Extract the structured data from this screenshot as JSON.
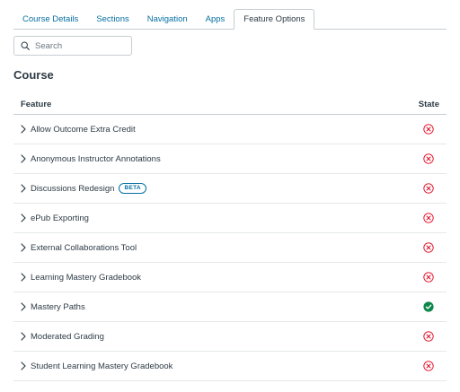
{
  "tabs": [
    {
      "label": "Course Details",
      "active": false
    },
    {
      "label": "Sections",
      "active": false
    },
    {
      "label": "Navigation",
      "active": false
    },
    {
      "label": "Apps",
      "active": false
    },
    {
      "label": "Feature Options",
      "active": true
    }
  ],
  "search": {
    "placeholder": "Search",
    "value": ""
  },
  "section_title": "Course",
  "table": {
    "headers": {
      "feature": "Feature",
      "state": "State"
    },
    "rows": [
      {
        "label": "Allow Outcome Extra Credit",
        "badge": "",
        "state": "off"
      },
      {
        "label": "Anonymous Instructor Annotations",
        "badge": "",
        "state": "off"
      },
      {
        "label": "Discussions Redesign",
        "badge": "BETA",
        "state": "off"
      },
      {
        "label": "ePub Exporting",
        "badge": "",
        "state": "off"
      },
      {
        "label": "External Collaborations Tool",
        "badge": "",
        "state": "off"
      },
      {
        "label": "Learning Mastery Gradebook",
        "badge": "",
        "state": "off"
      },
      {
        "label": "Mastery Paths",
        "badge": "",
        "state": "on"
      },
      {
        "label": "Moderated Grading",
        "badge": "",
        "state": "off"
      },
      {
        "label": "Student Learning Mastery Gradebook",
        "badge": "",
        "state": "off"
      }
    ]
  },
  "colors": {
    "link": "#0770a3",
    "state_off": "#e0061f",
    "state_on": "#0b874b",
    "text": "#2d3b45"
  },
  "icons": {
    "search": "search-icon",
    "expand": "chevron-right-icon",
    "state_off": "x-circle-icon",
    "state_on": "check-circle-icon"
  }
}
